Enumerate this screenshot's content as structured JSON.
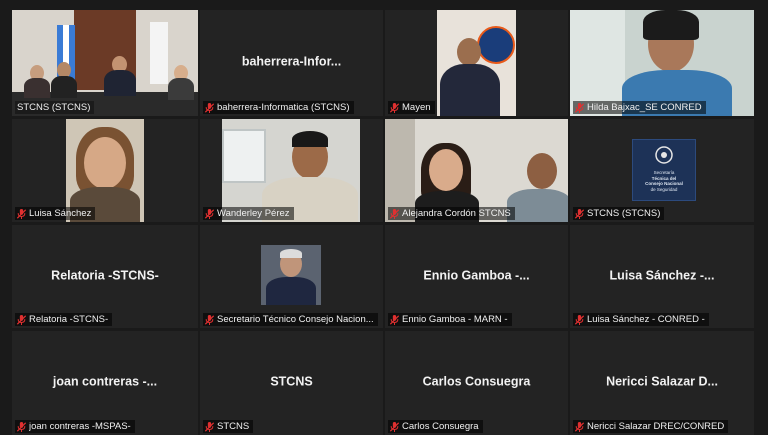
{
  "tiles": [
    {
      "label": "STCNS (STCNS)"
    },
    {
      "label": "baherrera-Informatica (STCNS)",
      "center": "baherrera-Infor..."
    },
    {
      "label": "Mayen"
    },
    {
      "label": "Hilda Bajxac_SE CONRED"
    },
    {
      "label": "Luisa Sánchez"
    },
    {
      "label": "Wanderley Pérez"
    },
    {
      "label": "Alejandra Cordón STCNS"
    },
    {
      "label": "STCNS (STCNS)"
    },
    {
      "label": "Relatoria -STCNS-",
      "center": "Relatoria -STCNS-"
    },
    {
      "label": "Secretario Técnico Consejo Nacion..."
    },
    {
      "label": "Ennio Gamboa - MARN -",
      "center": "Ennio Gamboa -..."
    },
    {
      "label": "Luisa Sánchez - CONRED -",
      "center": "Luisa Sánchez -..."
    },
    {
      "label": "joan contreras -MSPAS-",
      "center": "joan contreras -..."
    },
    {
      "label": "STCNS",
      "center": "STCNS"
    },
    {
      "label": "Carlos Consuegra",
      "center": "Carlos Consuegra"
    },
    {
      "label": "Nericci Salazar DREC/CONRED",
      "center": "Nericci Salazar D..."
    }
  ],
  "logo": {
    "line1": "Secretaría",
    "line2": "Técnica del",
    "line3": "Consejo Nacional",
    "line4": "de Seguridad"
  },
  "colors": {
    "active_border": "#d8d43a",
    "mic_muted": "#e03030",
    "tile_bg": "#232323"
  }
}
